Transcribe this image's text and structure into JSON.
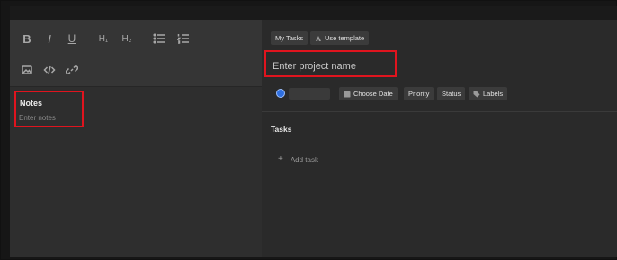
{
  "toolbar": {
    "bold": "B",
    "italic": "I",
    "underline": "U",
    "h1": "H₁",
    "h2": "H₂"
  },
  "notes": {
    "title": "Notes",
    "placeholder": "Enter notes"
  },
  "header_chips": {
    "my_tasks": "My Tasks",
    "use_template": "Use template"
  },
  "project": {
    "placeholder": "Enter project name"
  },
  "meta_chips": {
    "choose_date": "Choose Date",
    "priority": "Priority",
    "status": "Status",
    "labels": "Labels"
  },
  "tasks": {
    "title": "Tasks",
    "add_task": "Add task"
  },
  "colors": {
    "highlight_box": "#e0141e",
    "avatar": "#2f6fe0"
  }
}
